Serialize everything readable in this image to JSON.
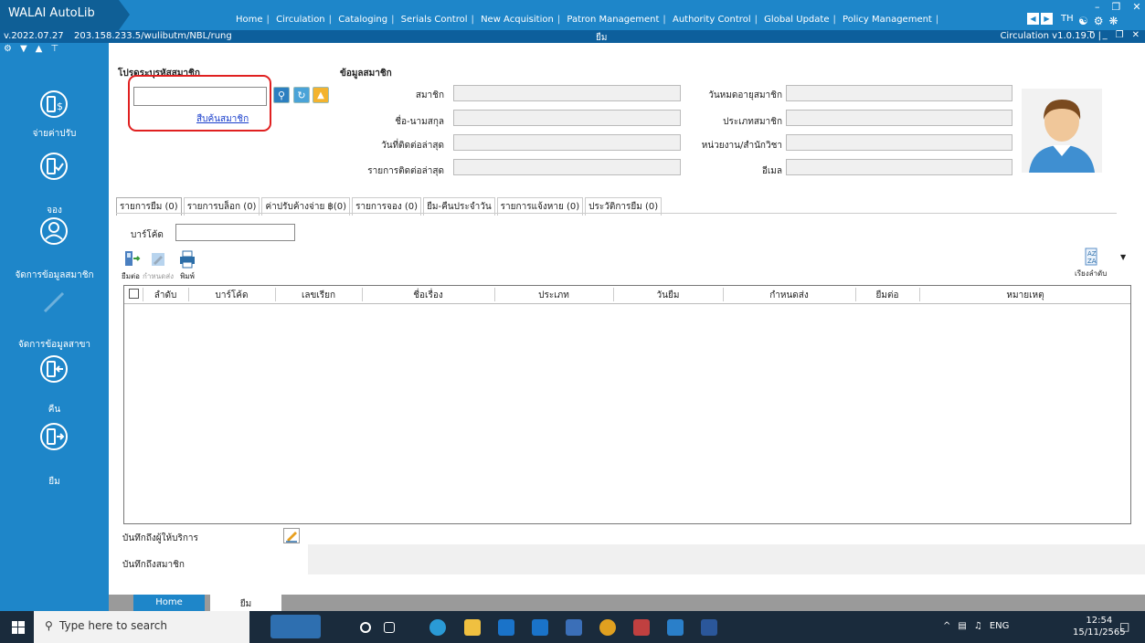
{
  "app": {
    "name": "WALAI AutoLib",
    "version": "v.2022.07.27",
    "server": "203.158.233.5/wulibutm/NBL/rung",
    "form_title": "ยืม",
    "module_version": "Circulation v1.0.19.0 |",
    "lang": "TH"
  },
  "menu": [
    "Home",
    "Circulation",
    "Cataloging",
    "Serials Control",
    "New Acquisition",
    "Patron Management",
    "Authority Control",
    "Global Update",
    "Policy Management"
  ],
  "menu_sep": "|",
  "sidebar": {
    "items": [
      {
        "label": "จ่ายค่าปรับ",
        "icon": "fine-payment-icon"
      },
      {
        "label": "จอง",
        "icon": "reserve-icon"
      },
      {
        "label": "จัดการข้อมูลสมาชิก",
        "icon": "member-manage-icon"
      },
      {
        "label": "จัดการข้อมูลสาขา",
        "icon": "branch-manage-icon"
      },
      {
        "label": "คืน",
        "icon": "return-icon"
      },
      {
        "label": "ยืม",
        "icon": "borrow-icon"
      }
    ]
  },
  "patron_search": {
    "title": "โปรดระบุรหัสสมาชิก",
    "value": "",
    "find_link": "สืบค้นสมาชิก"
  },
  "member_info": {
    "title": "ข้อมูลสมาชิก",
    "left_labels": [
      "สมาชิก",
      "ชื่อ-นามสกุล",
      "วันที่ติดต่อล่าสุด",
      "รายการติดต่อล่าสุด"
    ],
    "right_labels": [
      "วันหมดอายุสมาชิก",
      "ประเภทสมาชิก",
      "หน่วยงาน/สำนักวิชา",
      "อีเมล"
    ]
  },
  "tabs": [
    "รายการยืม (0)",
    "รายการบล็อก (0)",
    "ค่าปรับค้างจ่าย ฿(0)",
    "รายการจอง (0)",
    "ยืม-คืนประจำวัน",
    "รายการแจ้งหาย (0)",
    "ประวัติการยืม (0)"
  ],
  "barcode_label": "บาร์โค้ด",
  "toolbar": {
    "renew": "ยืมต่อ",
    "due": "กำหนดส่ง",
    "print": "พิมพ์",
    "sort": "เรียงลำดับ"
  },
  "grid_columns": [
    "ลำดับ",
    "บาร์โค้ด",
    "เลขเรียก",
    "ชื่อเรื่อง",
    "ประเภท",
    "วันยืม",
    "กำหนดส่ง",
    "ยืมต่อ",
    "หมายเหตุ"
  ],
  "notes": {
    "staff": "บันทึกถึงผู้ให้บริการ",
    "member": "บันทึกถึงสมาชิก"
  },
  "bottom_tabs": [
    "Home",
    "ยืม"
  ],
  "taskbar": {
    "search_placeholder": "Type here to search",
    "tray_lang": "ENG",
    "time": "12:54",
    "date": "15/11/2565"
  },
  "colors": {
    "brand": "#1e86c9",
    "dark": "#0d5f9c",
    "highlight": "#e02020"
  }
}
